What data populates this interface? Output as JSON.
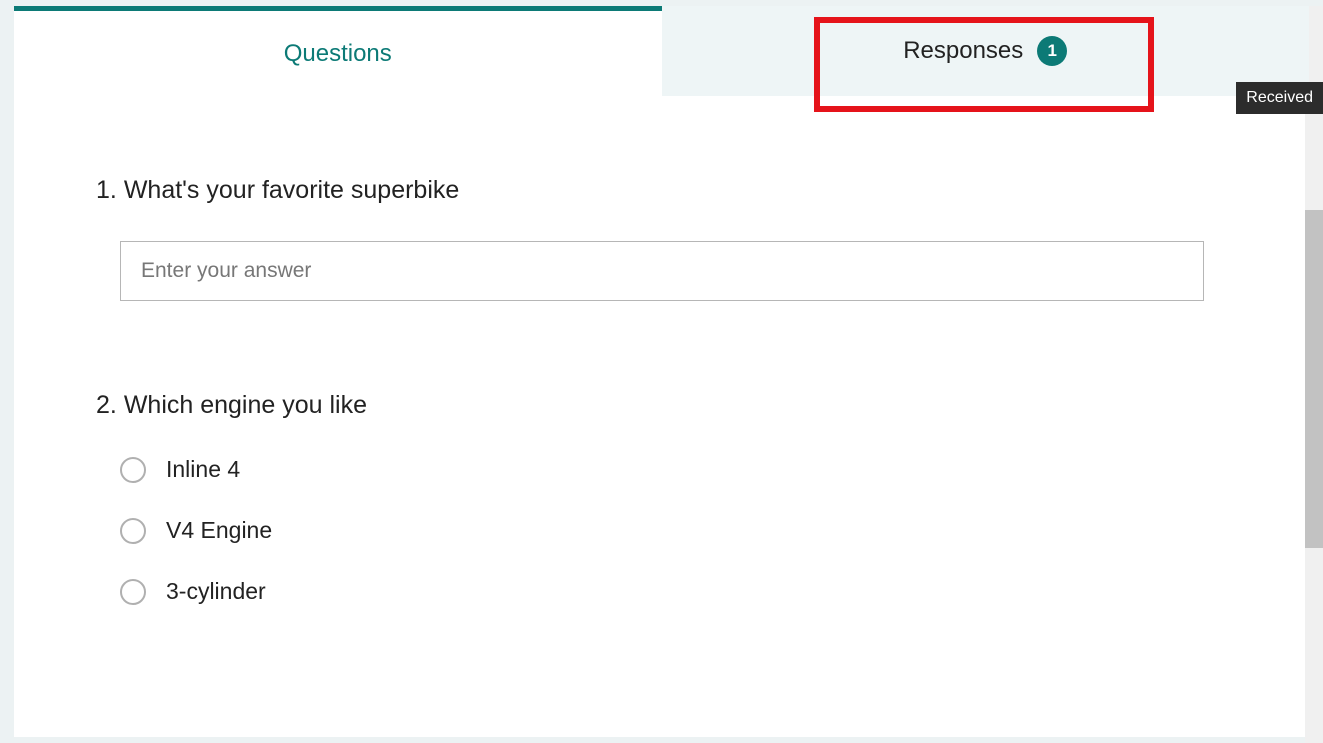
{
  "tabs": {
    "questions_label": "Questions",
    "responses_label": "Responses",
    "responses_count": "1"
  },
  "tooltip": {
    "received": "Received"
  },
  "questions": [
    {
      "number": "1",
      "text": "What's your favorite superbike",
      "type": "text",
      "placeholder": "Enter your answer"
    },
    {
      "number": "2",
      "text": "Which engine you like",
      "type": "choice",
      "options": [
        "Inline 4",
        "V4 Engine",
        "3-cylinder"
      ]
    }
  ]
}
